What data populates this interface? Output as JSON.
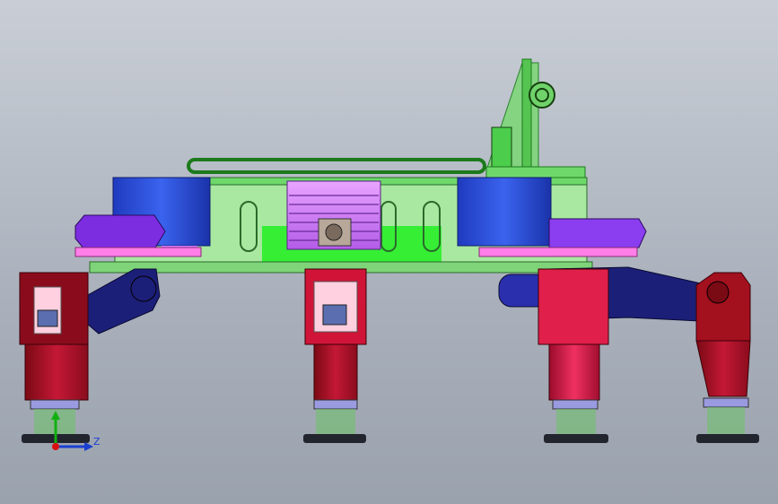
{
  "viewport": {
    "background_top": "#c9ced6",
    "background_bottom": "#9aa2ad"
  },
  "model": {
    "colors": {
      "frame_green": "#4fe04f",
      "frame_light": "#a8e8a0",
      "drum_blue": "#2a4fd6",
      "cap_purple": "#8a3ef0",
      "motor_magenta": "#d87cff",
      "plate_pink": "#ff7ee8",
      "leg_red": "#c01030",
      "leg_darkred": "#7a0a14",
      "arm_navy": "#1c1f78",
      "spring_green": "#6fbf6a",
      "foot_dark": "#23252e"
    }
  },
  "triad": {
    "label_z": "Z",
    "icon": "coordinate-triad-icon",
    "x_color": "#d61010",
    "y_color": "#10b010",
    "z_color": "#1b3fd1"
  }
}
